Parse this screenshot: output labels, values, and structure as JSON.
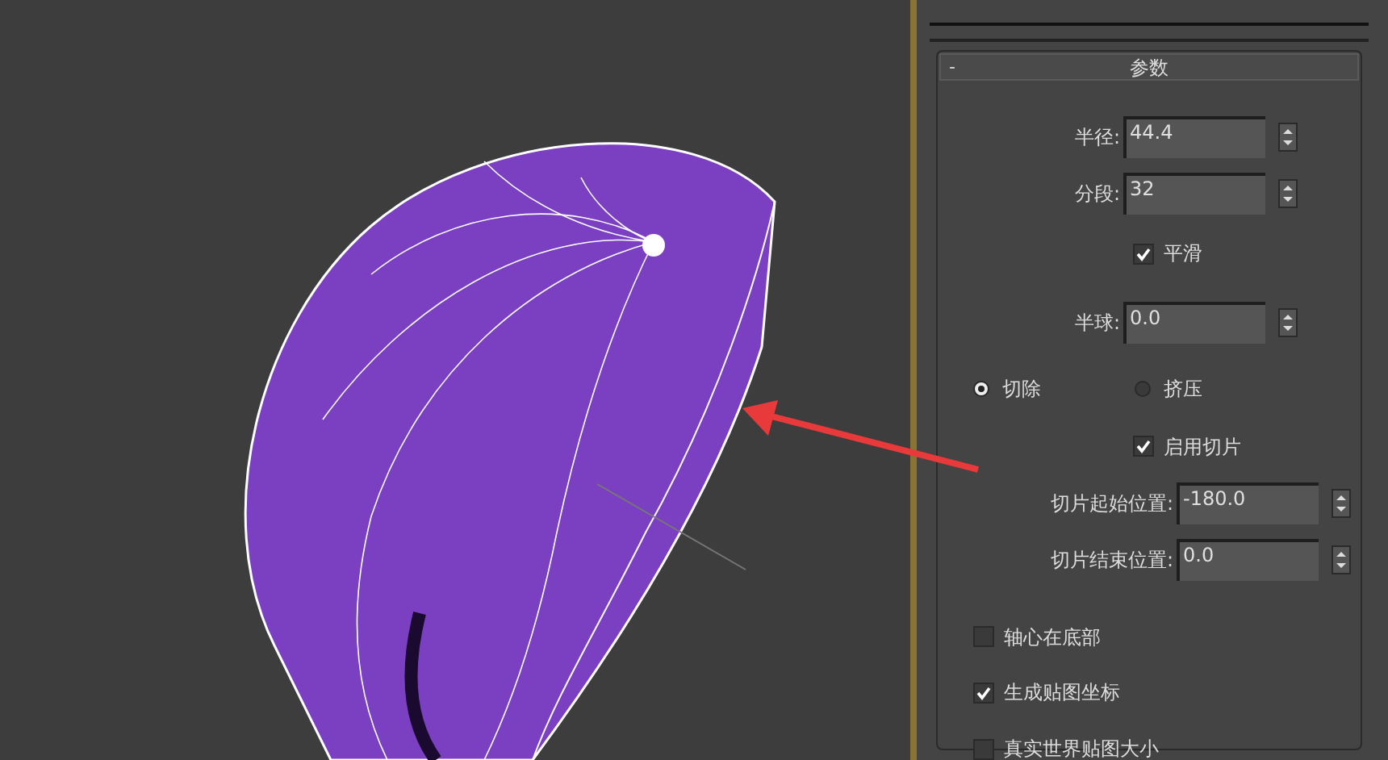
{
  "panel": {
    "collapse_label": "-",
    "rollout_title": "参数",
    "controls": [
      {
        "kind": "field",
        "label": "半径:",
        "value": "44.4"
      },
      {
        "kind": "field",
        "label": "分段:",
        "value": "32"
      },
      {
        "kind": "inset_checkbox",
        "label": "平滑",
        "checked": true
      },
      {
        "kind": "field",
        "label": "半球:",
        "value": "0.0"
      },
      {
        "kind": "radio_group",
        "options": [
          {
            "label": "切除",
            "selected": true
          },
          {
            "label": "挤压",
            "selected": false
          }
        ]
      },
      {
        "kind": "inset_checkbox",
        "label": "启用切片",
        "checked": true
      },
      {
        "kind": "wide_field",
        "label": "切片起始位置:",
        "value": "-180.0"
      },
      {
        "kind": "wide_field",
        "label": "切片结束位置:",
        "value": "0.0"
      },
      {
        "kind": "checkbox",
        "label": "轴心在底部",
        "checked": false
      },
      {
        "kind": "checkbox",
        "label": "生成贴图坐标",
        "checked": true
      },
      {
        "kind": "checkbox",
        "label": "真实世界贴图大小",
        "checked": false
      }
    ]
  }
}
